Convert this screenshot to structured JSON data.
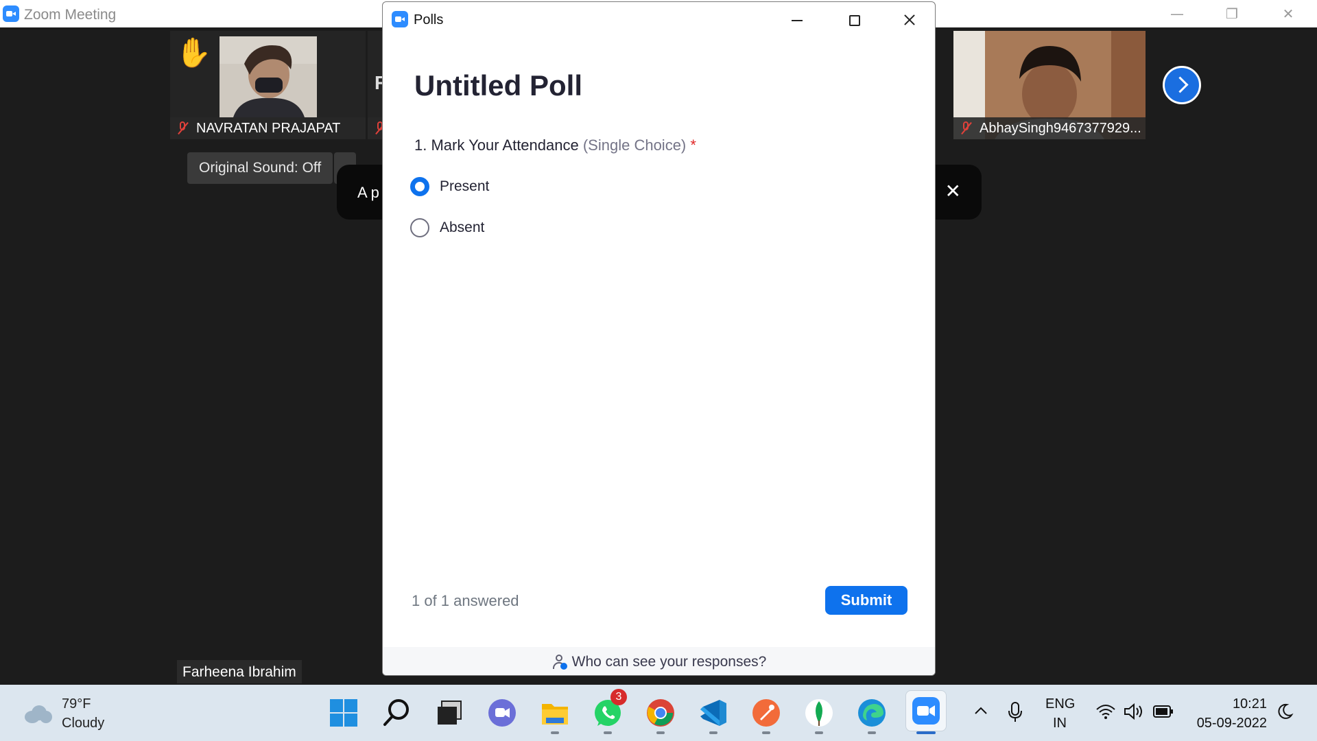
{
  "zoom_window": {
    "title": "Zoom Meeting"
  },
  "participants": {
    "tile1_name": "NAVRATAN PRAJAPAT",
    "tile2_partial_letter": "R",
    "tile3_name": "AbhaySingh9467377929...",
    "bottom_name": "Farheena Ibrahim"
  },
  "controls": {
    "original_sound": "Original Sound: Off"
  },
  "toast": {
    "text_partial": "A p"
  },
  "polls": {
    "window_title": "Polls",
    "heading": "Untitled Poll",
    "question": {
      "number_text": "1. Mark Your Attendance",
      "type": "(Single Choice)",
      "required_mark": "*"
    },
    "options": [
      {
        "label": "Present",
        "selected": true
      },
      {
        "label": "Absent",
        "selected": false
      }
    ],
    "answered_status": "1 of 1 answered",
    "submit_label": "Submit",
    "footer_text": "Who can see your responses?"
  },
  "taskbar": {
    "weather_temp": "79°F",
    "weather_desc": "Cloudy",
    "whatsapp_badge": "3",
    "lang_top": "ENG",
    "lang_bottom": "IN",
    "time": "10:21",
    "date": "05-09-2022"
  },
  "colors": {
    "zoom_blue": "#2d8cff",
    "submit_blue": "#0e72ed",
    "mute_red": "#e0413a",
    "taskbar_bg": "#dce6ef"
  }
}
